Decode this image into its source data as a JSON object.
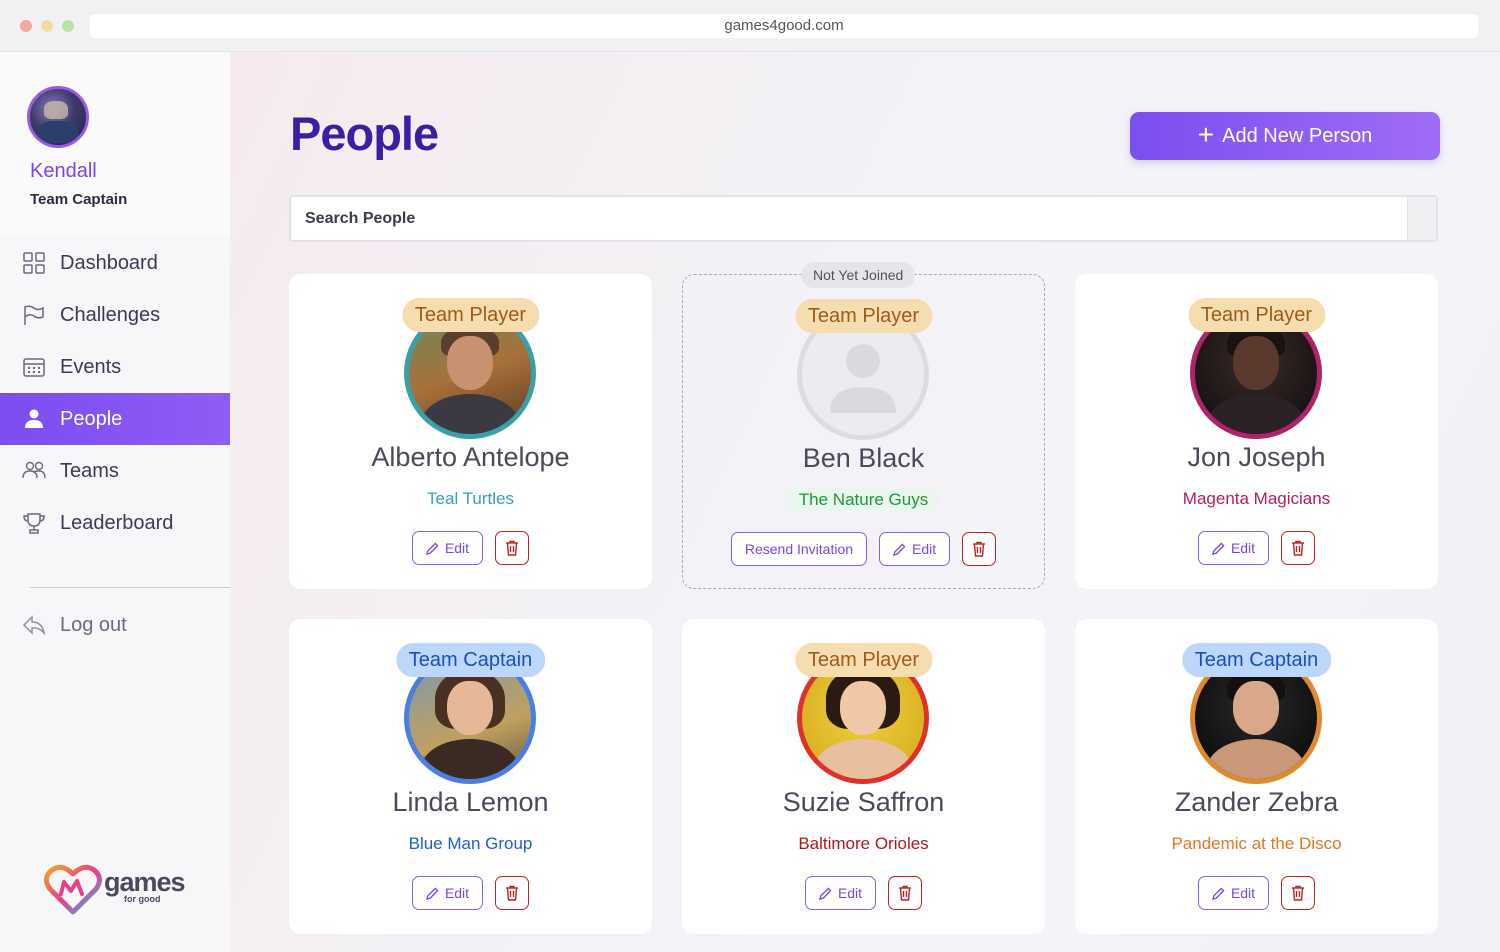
{
  "browser": {
    "url": "games4good.com"
  },
  "user": {
    "name": "Kendall",
    "role": "Team Captain"
  },
  "nav": {
    "items": [
      {
        "label": "Dashboard",
        "icon": "grid-icon"
      },
      {
        "label": "Challenges",
        "icon": "flag-icon"
      },
      {
        "label": "Events",
        "icon": "calendar-icon"
      },
      {
        "label": "People",
        "icon": "person-icon",
        "active": true
      },
      {
        "label": "Teams",
        "icon": "people-icon"
      },
      {
        "label": "Leaderboard",
        "icon": "trophy-icon"
      }
    ],
    "logout": "Log out"
  },
  "brand": {
    "name": "games",
    "tagline": "for good"
  },
  "page": {
    "title": "People",
    "add_button": "Add New Person",
    "search_placeholder": "Search People"
  },
  "people": [
    {
      "name": "Alberto Antelope",
      "role": "Team Player",
      "team": "Teal Turtles",
      "team_color": "#3aa0a8",
      "ring_color": "#3aa0a8",
      "edit": "Edit"
    },
    {
      "name": "Ben Black",
      "role": "Team Player",
      "team": "The Nature Guys",
      "team_color": "#1a9a3a",
      "ring_color": "#dcdce2",
      "edit": "Edit",
      "status": "Not Yet Joined",
      "resend": "Resend Invitation"
    },
    {
      "name": "Jon Joseph",
      "role": "Team Player",
      "team": "Magenta Magicians",
      "team_color": "#b21e5e",
      "ring_color": "#b0236a",
      "edit": "Edit"
    },
    {
      "name": "Linda Lemon",
      "role": "Team Captain",
      "team": "Blue Man Group",
      "team_color": "#1f5fcf",
      "ring_color": "#4a7ee0",
      "edit": "Edit"
    },
    {
      "name": "Suzie Saffron",
      "role": "Team Player",
      "team": "Baltimore Orioles",
      "team_color": "#b01818",
      "ring_color": "#e0302a",
      "edit": "Edit"
    },
    {
      "name": "Zander Zebra",
      "role": "Team Captain",
      "team": "Pandemic at the Disco",
      "team_color": "#e07820",
      "ring_color": "#e08a30",
      "edit": "Edit"
    }
  ],
  "colors": {
    "accent": "#7c4cf0",
    "title": "#3b1fa3",
    "delete": "#c02020"
  }
}
